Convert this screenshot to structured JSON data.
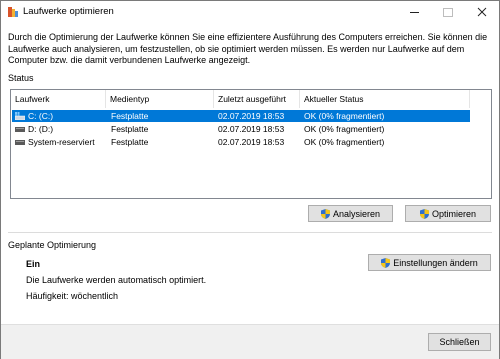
{
  "window": {
    "title": "Laufwerke optimieren"
  },
  "description": "Durch die Optimierung der Laufwerke können Sie eine effizientere Ausführung des Computers erreichen. Sie können die Laufwerke auch analysieren, um festzustellen, ob sie optimiert werden müssen. Es werden nur Laufwerke auf dem Computer bzw. die damit verbundenen Laufwerke angezeigt.",
  "status": {
    "label": "Status",
    "columns": [
      "Laufwerk",
      "Medientyp",
      "Zuletzt ausgeführt",
      "Aktueller Status"
    ],
    "rows": [
      {
        "drive": "C: (C:)",
        "media": "Festplatte",
        "last_run": "02.07.2019 18:53",
        "status": "OK (0% fragmentiert)",
        "selected": true,
        "icon": "windows-drive-icon"
      },
      {
        "drive": "D: (D:)",
        "media": "Festplatte",
        "last_run": "02.07.2019 18:53",
        "status": "OK (0% fragmentiert)",
        "selected": false,
        "icon": "drive-icon"
      },
      {
        "drive": "System-reserviert",
        "media": "Festplatte",
        "last_run": "02.07.2019 18:53",
        "status": "OK (0% fragmentiert)",
        "selected": false,
        "icon": "drive-icon"
      }
    ]
  },
  "buttons": {
    "analyze": "Analysieren",
    "optimize": "Optimieren",
    "change_settings": "Einstellungen ändern",
    "close": "Schließen"
  },
  "scheduled": {
    "label": "Geplante Optimierung",
    "state": "Ein",
    "info": "Die Laufwerke werden automatisch optimiert.",
    "frequency": "Häufigkeit: wöchentlich"
  },
  "colors": {
    "selection": "#0078d7",
    "button_face": "#e1e1e1",
    "footer": "#f0f0f0"
  }
}
